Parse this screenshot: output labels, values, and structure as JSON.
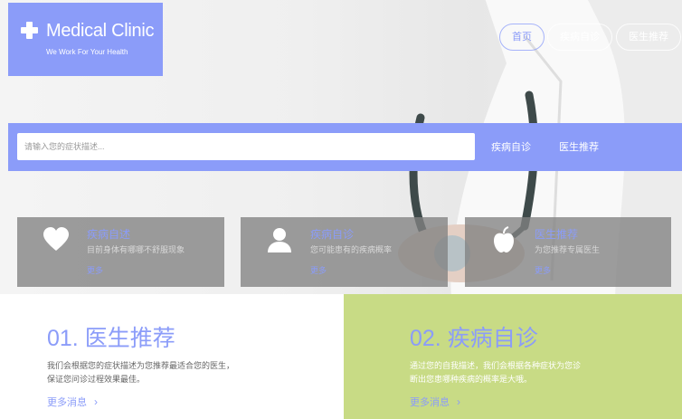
{
  "brand": {
    "name": "Medical Clinic",
    "tagline": "We Work For Your Health",
    "accent_color": "#8b9cf9",
    "secondary_color": "#c8db85"
  },
  "nav": {
    "home": "首页",
    "disease_check": "疾病自诊",
    "doctor_recommend": "医生推荐"
  },
  "search": {
    "placeholder": "请输入您的症状描述...",
    "disease_check": "疾病自诊",
    "doctor_recommend": "医生推荐"
  },
  "cards": [
    {
      "icon": "heart-icon",
      "title": "疾病自述",
      "desc": "目前身体有哪哪不舒服现象",
      "more": "更多"
    },
    {
      "icon": "user-icon",
      "title": "疾病自诊",
      "desc": "您可能患有的疾病概率",
      "more": "更多"
    },
    {
      "icon": "apple-icon",
      "title": "医生推荐",
      "desc": "为您推荐专属医生",
      "more": "更多"
    }
  ],
  "panels": {
    "left": {
      "title": "01. 医生推荐",
      "line1": "我们会根据您的症状描述为您推荐最适合您的医生，",
      "line2": "保证您问诊过程效果最佳。",
      "more": "更多消息",
      "chevron": "›"
    },
    "right": {
      "title": "02. 疾病自诊",
      "line1": "通过您的自我描述，我们会根据各种症状为您诊",
      "line2": "断出您患哪种疾病的概率是大哦。",
      "more": "更多消息",
      "chevron": "›"
    }
  }
}
